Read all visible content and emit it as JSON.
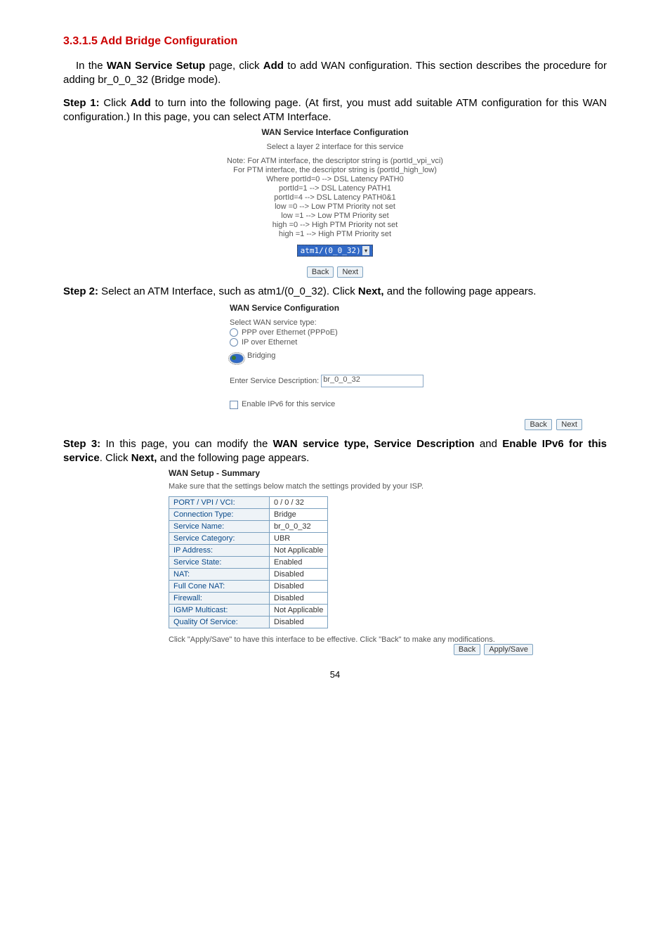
{
  "section_heading": "3.3.1.5 Add Bridge Configuration",
  "intro_p1a": "In the ",
  "intro_p1b": "WAN Service Setup",
  "intro_p1c": " page, click ",
  "intro_p1d": "Add",
  "intro_p1e": " to add WAN configuration. This section describes the procedure for adding br_0_0_32 (Bridge mode).",
  "step1_label": "Step 1:",
  "step1_a": " Click ",
  "step1_b": "Add",
  "step1_c": " to turn into the following page. (At first, you must add suitable ATM configuration for this WAN configuration.) In this page, you can select ATM Interface.",
  "shot1": {
    "title": "WAN Service Interface Configuration",
    "l0": "Select a layer 2 interface for this service",
    "l1": "Note: For ATM interface, the descriptor string is (portId_vpi_vci)",
    "l2": "For PTM interface, the descriptor string is (portId_high_low)",
    "l3": "Where portId=0 --> DSL Latency PATH0",
    "l4": "portId=1 --> DSL Latency PATH1",
    "l5": "portId=4 --> DSL Latency PATH0&1",
    "l6": "low  =0 --> Low PTM Priority not set",
    "l7": "low  =1 --> Low PTM Priority set",
    "l8": "high =0 --> High PTM Priority not set",
    "l9": "high =1 --> High PTM Priority set",
    "select_value": "atm1/(0_0_32)",
    "back": "Back",
    "next": "Next"
  },
  "step2_label": "Step 2:",
  "step2_a": " Select an ATM Interface, such as atm1/(0_0_32). Click ",
  "step2_b": "Next,",
  "step2_c": " and the following page appears.",
  "shot2": {
    "title": "WAN Service Configuration",
    "lbl": "Select WAN service type:",
    "r1": "PPP over Ethernet (PPPoE)",
    "r2": "IP over Ethernet",
    "r3": "Bridging",
    "svc_lbl": "Enter Service Description:",
    "svc_val": "br_0_0_32",
    "cb": "Enable IPv6 for this service",
    "back": "Back",
    "next": "Next"
  },
  "step3_label": "Step 3:",
  "step3_a": " In this page, you can modify the ",
  "step3_b": "WAN service type, Service Description",
  "step3_c": " and ",
  "step3_d": "Enable IPv6 for this service",
  "step3_e": ". Click ",
  "step3_f": "Next,",
  "step3_g": " and the following page appears.",
  "shot3": {
    "title": "WAN Setup - Summary",
    "sub": "Make sure that the settings below match the settings provided by your ISP.",
    "rows": [
      {
        "k": "PORT / VPI / VCI:",
        "v": "0 / 0 / 32"
      },
      {
        "k": "Connection Type:",
        "v": "Bridge"
      },
      {
        "k": "Service Name:",
        "v": "br_0_0_32"
      },
      {
        "k": "Service Category:",
        "v": "UBR"
      },
      {
        "k": "IP Address:",
        "v": "Not Applicable"
      },
      {
        "k": "Service State:",
        "v": "Enabled"
      },
      {
        "k": "NAT:",
        "v": "Disabled"
      },
      {
        "k": "Full Cone NAT:",
        "v": "Disabled"
      },
      {
        "k": "Firewall:",
        "v": "Disabled"
      },
      {
        "k": "IGMP Multicast:",
        "v": "Not Applicable"
      },
      {
        "k": "Quality Of Service:",
        "v": "Disabled"
      }
    ],
    "note": "Click \"Apply/Save\" to have this interface to be effective. Click \"Back\" to make any modifications.",
    "back": "Back",
    "apply": "Apply/Save"
  },
  "page_number": "54"
}
